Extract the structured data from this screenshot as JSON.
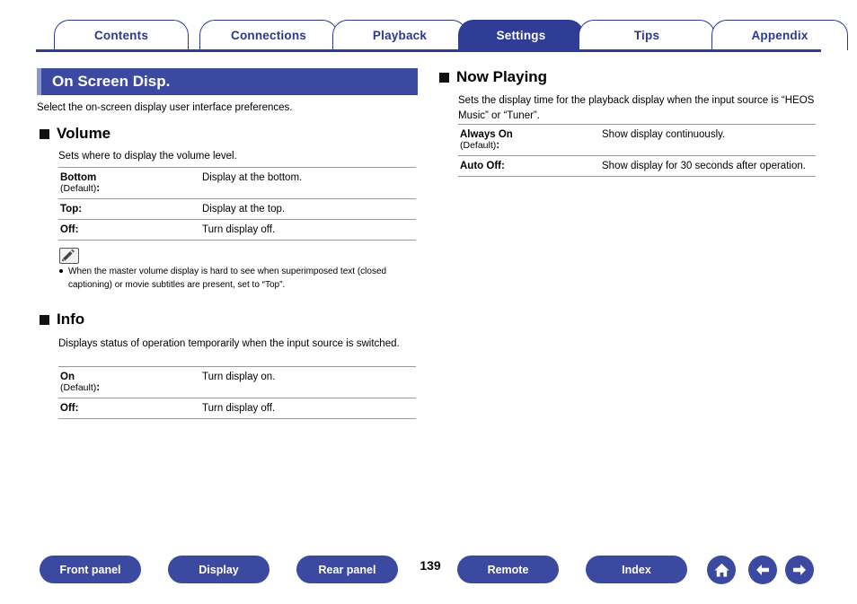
{
  "tabs": [
    {
      "label": "Contents",
      "active": false
    },
    {
      "label": "Connections",
      "active": false
    },
    {
      "label": "Playback",
      "active": false
    },
    {
      "label": "Settings",
      "active": true
    },
    {
      "label": "Tips",
      "active": false
    },
    {
      "label": "Appendix",
      "active": false
    }
  ],
  "page": {
    "title": "On Screen Disp.",
    "intro": "Select the on-screen display user interface preferences.",
    "number": "139"
  },
  "sections": {
    "volume": {
      "title": "Volume",
      "desc": "Sets where to display the volume level.",
      "rows": [
        {
          "key": "Bottom",
          "default": "(Default)",
          "colon": ":",
          "value": "Display at the bottom."
        },
        {
          "key": "Top:",
          "default": "",
          "colon": "",
          "value": "Display at the top."
        },
        {
          "key": "Off:",
          "default": "",
          "colon": "",
          "value": "Turn display off."
        }
      ],
      "note": "When the master volume display is hard to see when superimposed text (closed captioning) or movie subtitles are present, set to “Top”."
    },
    "info": {
      "title": "Info",
      "desc": "Displays status of operation temporarily when the input source is switched.",
      "rows": [
        {
          "key": "On",
          "default": "(Default)",
          "colon": ":",
          "value": "Turn display on."
        },
        {
          "key": "Off:",
          "default": "",
          "colon": "",
          "value": "Turn display off."
        }
      ]
    },
    "now_playing": {
      "title": "Now Playing",
      "desc": "Sets the display time for the playback display when the input source is “HEOS Music” or “Tuner”.",
      "rows": [
        {
          "key": "Always On",
          "default": "(Default)",
          "colon": ":",
          "value": "Show display continuously."
        },
        {
          "key": "Auto Off:",
          "default": "",
          "colon": "",
          "value": "Show display for 30 seconds after operation."
        }
      ]
    }
  },
  "footer": {
    "buttons": [
      {
        "label": "Front panel"
      },
      {
        "label": "Display"
      },
      {
        "label": "Rear panel"
      },
      {
        "label": "Remote"
      },
      {
        "label": "Index"
      }
    ],
    "icons": [
      {
        "name": "home-icon"
      },
      {
        "name": "arrow-left-icon"
      },
      {
        "name": "arrow-right-icon"
      }
    ]
  },
  "colors": {
    "accent": "#3b4aa0",
    "tab_border": "#2b3990",
    "active_tab": "#2f3d96"
  }
}
